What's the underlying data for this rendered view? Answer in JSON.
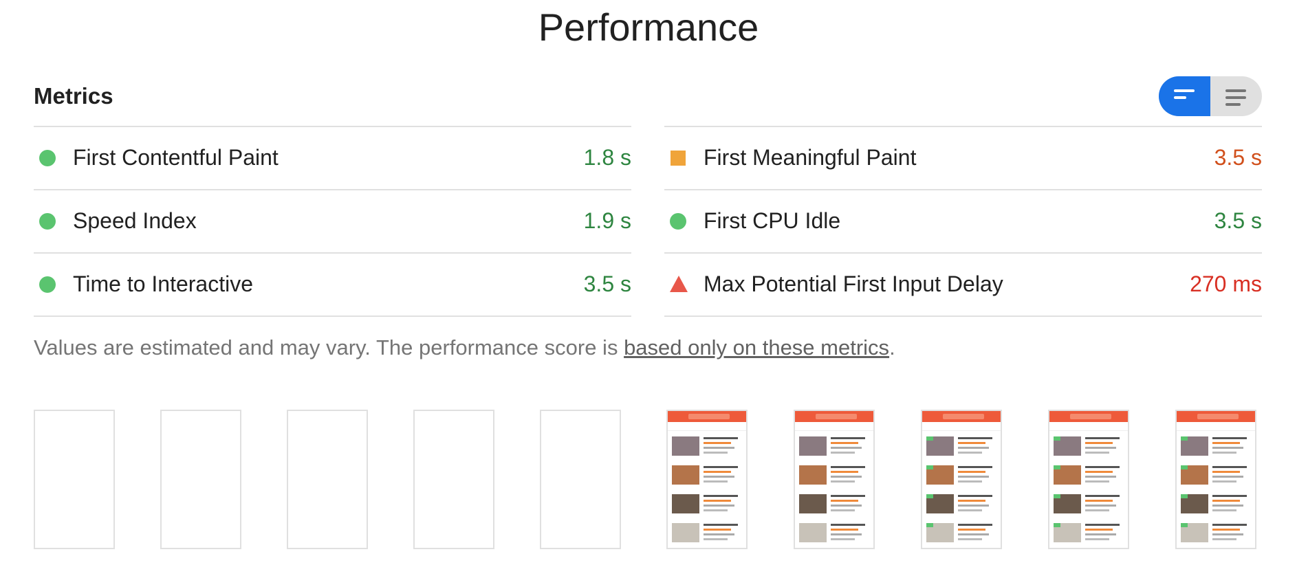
{
  "page": {
    "title": "Performance"
  },
  "metrics": {
    "heading": "Metrics",
    "toggle": {
      "options": [
        "expanded-view",
        "compact-view"
      ],
      "active_index": 0,
      "accent": "#1a73e8"
    },
    "left": [
      {
        "label": "First Contentful Paint",
        "value": "1.8 s",
        "rating": "pass"
      },
      {
        "label": "Speed Index",
        "value": "1.9 s",
        "rating": "pass"
      },
      {
        "label": "Time to Interactive",
        "value": "3.5 s",
        "rating": "pass"
      }
    ],
    "right": [
      {
        "label": "First Meaningful Paint",
        "value": "3.5 s",
        "rating": "average"
      },
      {
        "label": "First CPU Idle",
        "value": "3.5 s",
        "rating": "pass"
      },
      {
        "label": "Max Potential First Input Delay",
        "value": "270 ms",
        "rating": "fail"
      }
    ],
    "colors": {
      "pass": "#5ac46f",
      "average": "#f0a43a",
      "fail": "#e8574a"
    }
  },
  "note": {
    "prefix": "Values are estimated and may vary. The performance score is ",
    "link": "based only on these metrics",
    "suffix": "."
  },
  "filmstrip": {
    "frames": [
      {
        "state": "blank"
      },
      {
        "state": "blank"
      },
      {
        "state": "blank"
      },
      {
        "state": "blank"
      },
      {
        "state": "blank"
      },
      {
        "state": "loaded"
      },
      {
        "state": "loaded"
      },
      {
        "state": "loaded"
      },
      {
        "state": "loaded"
      },
      {
        "state": "loaded"
      }
    ]
  }
}
